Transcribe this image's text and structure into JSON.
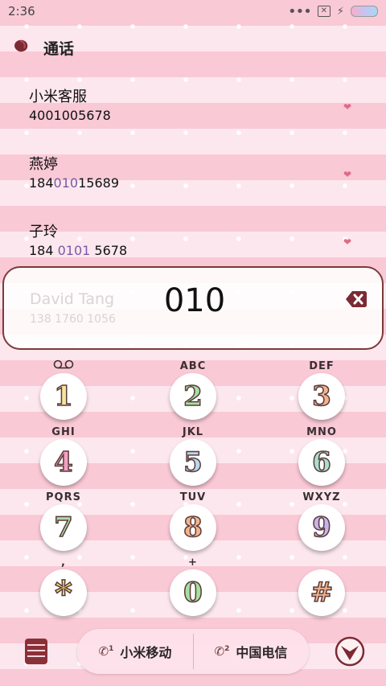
{
  "status": {
    "time": "2:36"
  },
  "header": {
    "title": "通话"
  },
  "contacts": [
    {
      "name": "小米客服",
      "number": "4001005678"
    },
    {
      "name": "燕婷",
      "number_pre": "184",
      "number_hl": "010",
      "number_post": "15689"
    },
    {
      "name": "子玲",
      "number_pre": "184 ",
      "number_hl": "0101",
      "number_post": " 5678"
    }
  ],
  "dialer": {
    "input": "010",
    "ghost_name": "David Tang",
    "ghost_number": "138 1760 1056"
  },
  "keys": [
    {
      "letters": "",
      "digit": "1",
      "color": "#f5e59a"
    },
    {
      "letters": "ABC",
      "digit": "2",
      "color": "#a6e0a1"
    },
    {
      "letters": "DEF",
      "digit": "3",
      "color": "#f3b48d"
    },
    {
      "letters": "GHI",
      "digit": "4",
      "color": "#f3a0c2"
    },
    {
      "letters": "JKL",
      "digit": "5",
      "color": "#b8d8ef"
    },
    {
      "letters": "MNO",
      "digit": "6",
      "color": "#a8e0cf"
    },
    {
      "letters": "PQRS",
      "digit": "7",
      "color": "#a6e0a1"
    },
    {
      "letters": "TUV",
      "digit": "8",
      "color": "#f3b48d"
    },
    {
      "letters": "WXYZ",
      "digit": "9",
      "color": "#c7b3ee"
    },
    {
      "letters": ",",
      "digit": "*",
      "color": "#eee07a"
    },
    {
      "letters": "+",
      "digit": "0",
      "color": "#a6e0a1"
    },
    {
      "letters": "",
      "digit": "#",
      "color": "#f3b48d"
    }
  ],
  "bottom": {
    "sim1_label": "小米移动",
    "sim2_label": "中国电信",
    "sim1_badge": "1",
    "sim2_badge": "2"
  }
}
